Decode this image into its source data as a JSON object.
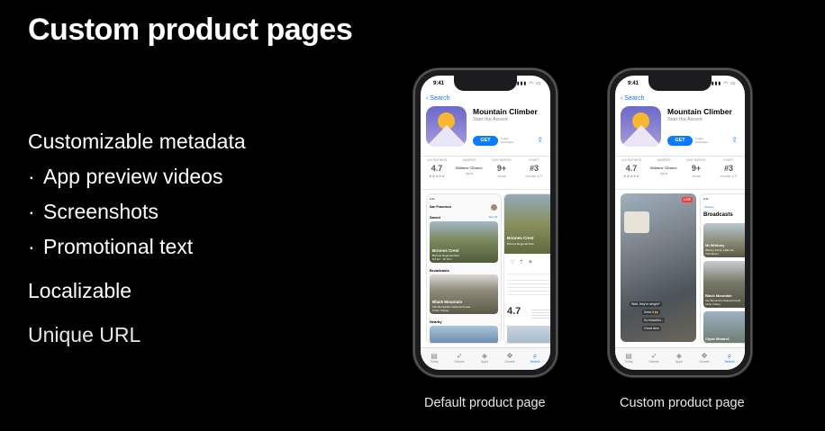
{
  "slide": {
    "title": "Custom product pages",
    "bullets": [
      {
        "text": "Customizable metadata",
        "dot": ""
      },
      {
        "text": "App preview videos",
        "dot": "·"
      },
      {
        "text": "Screenshots",
        "dot": "·"
      },
      {
        "text": "Promotional text",
        "dot": "·"
      },
      {
        "text": "Localizable",
        "dot": ""
      },
      {
        "text": "Unique URL",
        "dot": ""
      }
    ]
  },
  "phones": [
    {
      "caption": "Default product page",
      "time": "9:41",
      "back": "Search",
      "app_name": "Mountain Climber",
      "app_subtitle": "Start the Ascent",
      "get_label": "GET",
      "iap_label": "In-App Purchases",
      "ratings": [
        {
          "label": "41K RATINGS",
          "value": "4.7",
          "sub": "★★★★★"
        },
        {
          "label": "AWARDS",
          "value": "Editors' Choice",
          "sub": "Apps"
        },
        {
          "label": "AGE RATING",
          "value": "9+",
          "sub": "Years"
        },
        {
          "label": "CHART",
          "value": "#3",
          "sub": "Health & F"
        }
      ],
      "screens": {
        "location": "San Francisco",
        "saved": "Saved",
        "see_all": "See All",
        "card1_title": "Briones Crest",
        "card1_sub": "Briones Regional Park",
        "card1_meta": "5.6 km · 2h 15m",
        "broadcasts": "Broadcasts",
        "card2_title": "Black Mountain",
        "card2_sub": "San Bernardino National Forest",
        "card2_meta": "Cindy Chieng",
        "nearby": "Nearby",
        "detail_title": "Briones Crest",
        "detail_sub": "Briones Regional Park",
        "detail_rating": "4.7"
      }
    },
    {
      "caption": "Custom product page",
      "time": "9:41",
      "back": "Search",
      "app_name": "Mountain Climber",
      "app_subtitle": "Start the Ascent",
      "get_label": "GET",
      "iap_label": "In-App Purchases",
      "ratings": [
        {
          "label": "41K RATINGS",
          "value": "4.7",
          "sub": "★★★★★"
        },
        {
          "label": "AWARDS",
          "value": "Editors' Choice",
          "sub": "Apps"
        },
        {
          "label": "AGE RATING",
          "value": "9+",
          "sub": "Years"
        },
        {
          "label": "CHART",
          "value": "#3",
          "sub": "Health & F"
        }
      ],
      "screens": {
        "live": "LIVE",
        "chat1": "Wait, they're alright?",
        "chat2": "Send it 🙌",
        "chat3": "So beautiful...",
        "chat4": "Great view",
        "broadcasts": "Broadcasts",
        "back2": "Browse",
        "card1_title": "Mt Whitney",
        "card1_sub": "Whitney Portal, California",
        "card1_meta": "Chris Beam",
        "card2_title": "Black Mountain",
        "card2_sub": "San Bernardino National Forest",
        "card2_meta": "Cindy Chieng",
        "card3_title": "Clyde Minaret"
      }
    }
  ],
  "tabs": [
    "Today",
    "Games",
    "Apps",
    "Arcade",
    "Search"
  ],
  "colors": {
    "accent": "#0a7aff",
    "background": "#000000",
    "icon_bg": "#6b69c9",
    "sun": "#f7b731"
  }
}
